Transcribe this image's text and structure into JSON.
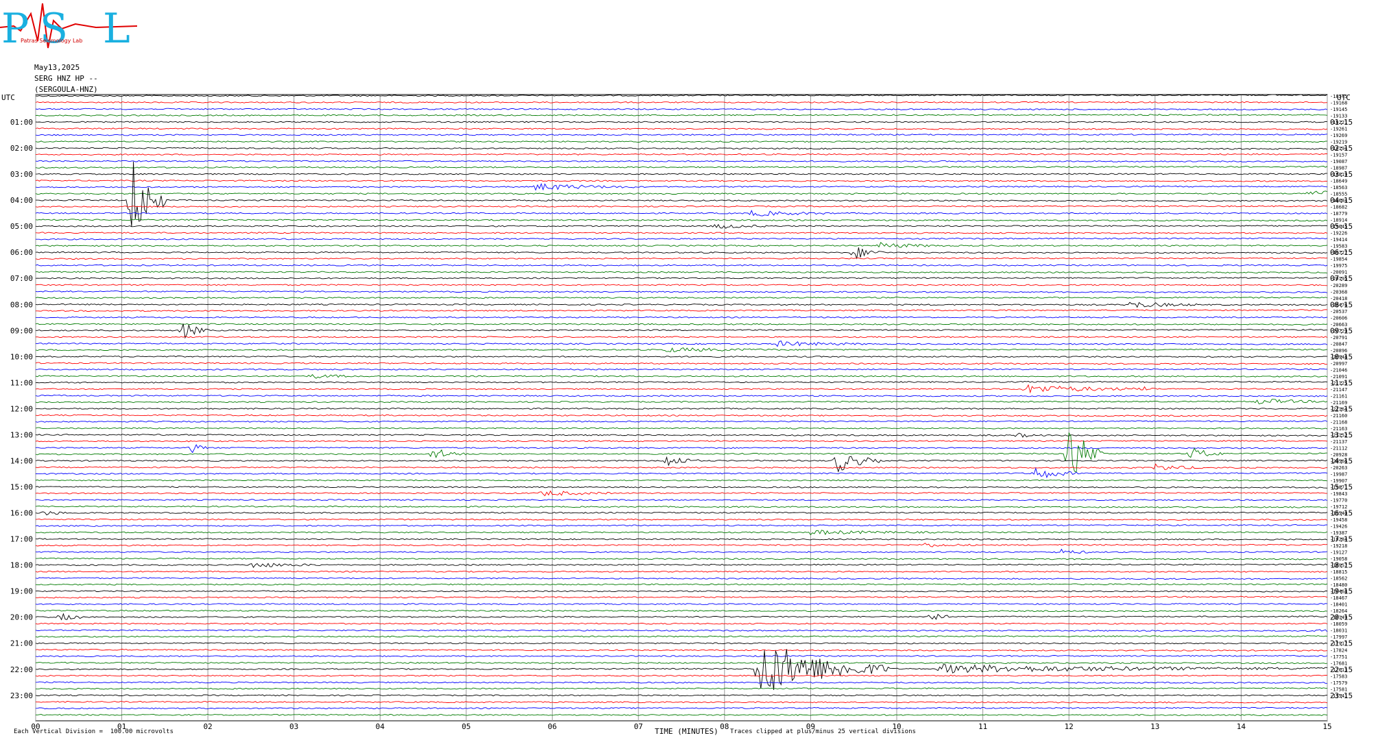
{
  "logo": {
    "letters": [
      "P",
      "S",
      "L"
    ],
    "text": "Patras Seismology Lab"
  },
  "header": {
    "date": "May13,2025",
    "station": "SERG HNZ HP --",
    "site": "(SERGOULA-HNZ)"
  },
  "utc_left_label": "UTC",
  "utc_right_label": "UTC",
  "colors": {
    "cycle": [
      "#000000",
      "#ff0000",
      "#0000ff",
      "#007a00"
    ],
    "grid": "#999999"
  },
  "chart_data": {
    "type": "line",
    "x": {
      "label": "TIME (MINUTES)",
      "ticks": [
        "00",
        "01",
        "02",
        "03",
        "04",
        "05",
        "06",
        "07",
        "08",
        "09",
        "10",
        "11",
        "12",
        "13",
        "14",
        "15"
      ],
      "lim": [
        0,
        15
      ]
    },
    "left_labels": [
      "01:00",
      "02:00",
      "03:00",
      "04:00",
      "05:00",
      "06:00",
      "07:00",
      "08:00",
      "09:00",
      "10:00",
      "11:00",
      "12:00",
      "13:00",
      "14:00",
      "15:00",
      "16:00",
      "17:00",
      "18:00",
      "19:00",
      "20:00",
      "21:00",
      "22:00",
      "23:00"
    ],
    "right_labels": [
      "01:15",
      "02:15",
      "03:15",
      "04:15",
      "05:15",
      "06:15",
      "07:15",
      "08:15",
      "09:15",
      "10:15",
      "11:15",
      "12:15",
      "13:15",
      "14:15",
      "15:15",
      "16:15",
      "17:15",
      "18:15",
      "19:15",
      "20:15",
      "21:15",
      "22:15",
      "23:15"
    ],
    "trace_count": 96,
    "mean_values": [
      "-18545",
      "-19168",
      "-19145",
      "-19133",
      "-19221",
      "-19261",
      "-19269",
      "-19219",
      "-19194",
      "-19157",
      "-19087",
      "-18987",
      "-18819",
      "-18649",
      "-18563",
      "-18555",
      "-18684",
      "-18682",
      "-18779",
      "-18914",
      "-19045",
      "-19226",
      "-19414",
      "-19583",
      "-19727",
      "-19854",
      "-19975",
      "-20091",
      "-20195",
      "-20289",
      "-20368",
      "-20418",
      "-20476",
      "-20537",
      "-20606",
      "-20663",
      "-20729",
      "-20791",
      "-20847",
      "-20896",
      "-20948",
      "-20997",
      "-21046",
      "-21091",
      "-21125",
      "-21147",
      "-21161",
      "-21169",
      "-21164",
      "-21160",
      "-21168",
      "-21163",
      "-21152",
      "-21137",
      "-21112",
      "-20928",
      "-20566",
      "-20263",
      "-19987",
      "-19907",
      "-19871",
      "-19843",
      "-19770",
      "-19712",
      "-19540",
      "-19458",
      "-19426",
      "-19387",
      "-19284",
      "-19218",
      "-19127",
      "-19058",
      "-18957",
      "-18815",
      "-18562",
      "-18480",
      "-18468",
      "-18467",
      "-18401",
      "-18264",
      "-18149",
      "-18059",
      "-18031",
      "-17997",
      "-17917",
      "-17824",
      "-17751",
      "-17681",
      "-17613",
      "-17583",
      "-17579",
      "-17581",
      "-17541"
    ],
    "events": [
      {
        "trace": 16,
        "minute": 1.1,
        "amp": 75,
        "dur": 0.4
      },
      {
        "trace": 14,
        "minute": 5.8,
        "amp": 5,
        "dur": 1.2
      },
      {
        "trace": 15,
        "minute": 14.8,
        "amp": 8,
        "dur": 0.4
      },
      {
        "trace": 18,
        "minute": 8.3,
        "amp": 4,
        "dur": 1.0
      },
      {
        "trace": 20,
        "minute": 7.9,
        "amp": 4,
        "dur": 0.6
      },
      {
        "trace": 23,
        "minute": 9.8,
        "amp": 4,
        "dur": 0.8
      },
      {
        "trace": 24,
        "minute": 9.5,
        "amp": 10,
        "dur": 0.4
      },
      {
        "trace": 32,
        "minute": 12.7,
        "amp": 5,
        "dur": 0.8
      },
      {
        "trace": 36,
        "minute": 1.7,
        "amp": 14,
        "dur": 0.3
      },
      {
        "trace": 38,
        "minute": 8.6,
        "amp": 4,
        "dur": 1.0
      },
      {
        "trace": 39,
        "minute": 7.3,
        "amp": 3,
        "dur": 1.5
      },
      {
        "trace": 43,
        "minute": 3.2,
        "amp": 3,
        "dur": 0.6
      },
      {
        "trace": 45,
        "minute": 11.5,
        "amp": 6,
        "dur": 1.5
      },
      {
        "trace": 45,
        "minute": 12.9,
        "amp": 8,
        "dur": 0.1
      },
      {
        "trace": 47,
        "minute": 14.2,
        "amp": 4,
        "dur": 0.8
      },
      {
        "trace": 52,
        "minute": 11.4,
        "amp": 3,
        "dur": 0.3
      },
      {
        "trace": 54,
        "minute": 1.8,
        "amp": 8,
        "dur": 0.2
      },
      {
        "trace": 55,
        "minute": 4.6,
        "amp": 10,
        "dur": 0.4
      },
      {
        "trace": 55,
        "minute": 12.0,
        "amp": 50,
        "dur": 0.4
      },
      {
        "trace": 55,
        "minute": 13.4,
        "amp": 10,
        "dur": 0.4
      },
      {
        "trace": 56,
        "minute": 7.3,
        "amp": 10,
        "dur": 0.4
      },
      {
        "trace": 56,
        "minute": 9.3,
        "amp": 18,
        "dur": 0.5
      },
      {
        "trace": 58,
        "minute": 11.6,
        "amp": 10,
        "dur": 0.5
      },
      {
        "trace": 57,
        "minute": 13.0,
        "amp": 5,
        "dur": 0.6
      },
      {
        "trace": 61,
        "minute": 5.9,
        "amp": 4,
        "dur": 0.8
      },
      {
        "trace": 64,
        "minute": 0.1,
        "amp": 4,
        "dur": 0.3
      },
      {
        "trace": 67,
        "minute": 9.0,
        "amp": 3,
        "dur": 1.5
      },
      {
        "trace": 69,
        "minute": 10.3,
        "amp": 3,
        "dur": 0.6
      },
      {
        "trace": 70,
        "minute": 11.9,
        "amp": 4,
        "dur": 0.4
      },
      {
        "trace": 72,
        "minute": 2.5,
        "amp": 4,
        "dur": 0.8
      },
      {
        "trace": 80,
        "minute": 0.3,
        "amp": 5,
        "dur": 0.3
      },
      {
        "trace": 80,
        "minute": 10.4,
        "amp": 9,
        "dur": 0.2
      },
      {
        "trace": 82,
        "minute": 14.9,
        "amp": 4,
        "dur": 0.3
      },
      {
        "trace": 88,
        "minute": 8.4,
        "amp": 45,
        "dur": 1.5
      },
      {
        "trace": 88,
        "minute": 10.5,
        "amp": 6,
        "dur": 4.5
      }
    ]
  },
  "footer": {
    "division": "Each Vertical Division =  100.00 microvolts",
    "clipped": "Traces clipped at plus/minus 25 vertical divisions"
  }
}
